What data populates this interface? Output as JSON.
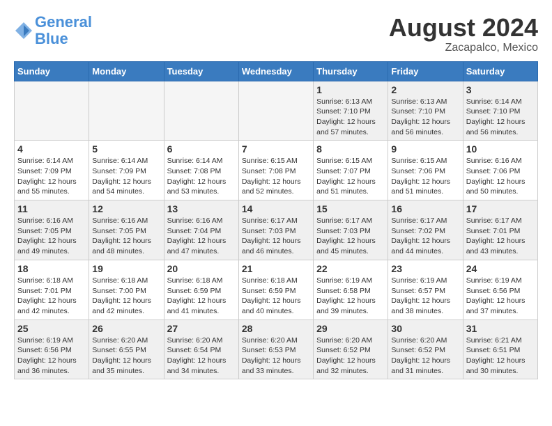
{
  "header": {
    "logo_line1": "General",
    "logo_line2": "Blue",
    "month_title": "August 2024",
    "location": "Zacapalco, Mexico"
  },
  "weekdays": [
    "Sunday",
    "Monday",
    "Tuesday",
    "Wednesday",
    "Thursday",
    "Friday",
    "Saturday"
  ],
  "weeks": [
    [
      {
        "day": "",
        "info": "",
        "empty": true
      },
      {
        "day": "",
        "info": "",
        "empty": true
      },
      {
        "day": "",
        "info": "",
        "empty": true
      },
      {
        "day": "",
        "info": "",
        "empty": true
      },
      {
        "day": "1",
        "info": "Sunrise: 6:13 AM\nSunset: 7:10 PM\nDaylight: 12 hours\nand 57 minutes.",
        "empty": false
      },
      {
        "day": "2",
        "info": "Sunrise: 6:13 AM\nSunset: 7:10 PM\nDaylight: 12 hours\nand 56 minutes.",
        "empty": false
      },
      {
        "day": "3",
        "info": "Sunrise: 6:14 AM\nSunset: 7:10 PM\nDaylight: 12 hours\nand 56 minutes.",
        "empty": false
      }
    ],
    [
      {
        "day": "4",
        "info": "Sunrise: 6:14 AM\nSunset: 7:09 PM\nDaylight: 12 hours\nand 55 minutes.",
        "empty": false
      },
      {
        "day": "5",
        "info": "Sunrise: 6:14 AM\nSunset: 7:09 PM\nDaylight: 12 hours\nand 54 minutes.",
        "empty": false
      },
      {
        "day": "6",
        "info": "Sunrise: 6:14 AM\nSunset: 7:08 PM\nDaylight: 12 hours\nand 53 minutes.",
        "empty": false
      },
      {
        "day": "7",
        "info": "Sunrise: 6:15 AM\nSunset: 7:08 PM\nDaylight: 12 hours\nand 52 minutes.",
        "empty": false
      },
      {
        "day": "8",
        "info": "Sunrise: 6:15 AM\nSunset: 7:07 PM\nDaylight: 12 hours\nand 51 minutes.",
        "empty": false
      },
      {
        "day": "9",
        "info": "Sunrise: 6:15 AM\nSunset: 7:06 PM\nDaylight: 12 hours\nand 51 minutes.",
        "empty": false
      },
      {
        "day": "10",
        "info": "Sunrise: 6:16 AM\nSunset: 7:06 PM\nDaylight: 12 hours\nand 50 minutes.",
        "empty": false
      }
    ],
    [
      {
        "day": "11",
        "info": "Sunrise: 6:16 AM\nSunset: 7:05 PM\nDaylight: 12 hours\nand 49 minutes.",
        "empty": false
      },
      {
        "day": "12",
        "info": "Sunrise: 6:16 AM\nSunset: 7:05 PM\nDaylight: 12 hours\nand 48 minutes.",
        "empty": false
      },
      {
        "day": "13",
        "info": "Sunrise: 6:16 AM\nSunset: 7:04 PM\nDaylight: 12 hours\nand 47 minutes.",
        "empty": false
      },
      {
        "day": "14",
        "info": "Sunrise: 6:17 AM\nSunset: 7:03 PM\nDaylight: 12 hours\nand 46 minutes.",
        "empty": false
      },
      {
        "day": "15",
        "info": "Sunrise: 6:17 AM\nSunset: 7:03 PM\nDaylight: 12 hours\nand 45 minutes.",
        "empty": false
      },
      {
        "day": "16",
        "info": "Sunrise: 6:17 AM\nSunset: 7:02 PM\nDaylight: 12 hours\nand 44 minutes.",
        "empty": false
      },
      {
        "day": "17",
        "info": "Sunrise: 6:17 AM\nSunset: 7:01 PM\nDaylight: 12 hours\nand 43 minutes.",
        "empty": false
      }
    ],
    [
      {
        "day": "18",
        "info": "Sunrise: 6:18 AM\nSunset: 7:01 PM\nDaylight: 12 hours\nand 42 minutes.",
        "empty": false
      },
      {
        "day": "19",
        "info": "Sunrise: 6:18 AM\nSunset: 7:00 PM\nDaylight: 12 hours\nand 42 minutes.",
        "empty": false
      },
      {
        "day": "20",
        "info": "Sunrise: 6:18 AM\nSunset: 6:59 PM\nDaylight: 12 hours\nand 41 minutes.",
        "empty": false
      },
      {
        "day": "21",
        "info": "Sunrise: 6:18 AM\nSunset: 6:59 PM\nDaylight: 12 hours\nand 40 minutes.",
        "empty": false
      },
      {
        "day": "22",
        "info": "Sunrise: 6:19 AM\nSunset: 6:58 PM\nDaylight: 12 hours\nand 39 minutes.",
        "empty": false
      },
      {
        "day": "23",
        "info": "Sunrise: 6:19 AM\nSunset: 6:57 PM\nDaylight: 12 hours\nand 38 minutes.",
        "empty": false
      },
      {
        "day": "24",
        "info": "Sunrise: 6:19 AM\nSunset: 6:56 PM\nDaylight: 12 hours\nand 37 minutes.",
        "empty": false
      }
    ],
    [
      {
        "day": "25",
        "info": "Sunrise: 6:19 AM\nSunset: 6:56 PM\nDaylight: 12 hours\nand 36 minutes.",
        "empty": false
      },
      {
        "day": "26",
        "info": "Sunrise: 6:20 AM\nSunset: 6:55 PM\nDaylight: 12 hours\nand 35 minutes.",
        "empty": false
      },
      {
        "day": "27",
        "info": "Sunrise: 6:20 AM\nSunset: 6:54 PM\nDaylight: 12 hours\nand 34 minutes.",
        "empty": false
      },
      {
        "day": "28",
        "info": "Sunrise: 6:20 AM\nSunset: 6:53 PM\nDaylight: 12 hours\nand 33 minutes.",
        "empty": false
      },
      {
        "day": "29",
        "info": "Sunrise: 6:20 AM\nSunset: 6:52 PM\nDaylight: 12 hours\nand 32 minutes.",
        "empty": false
      },
      {
        "day": "30",
        "info": "Sunrise: 6:20 AM\nSunset: 6:52 PM\nDaylight: 12 hours\nand 31 minutes.",
        "empty": false
      },
      {
        "day": "31",
        "info": "Sunrise: 6:21 AM\nSunset: 6:51 PM\nDaylight: 12 hours\nand 30 minutes.",
        "empty": false
      }
    ]
  ]
}
